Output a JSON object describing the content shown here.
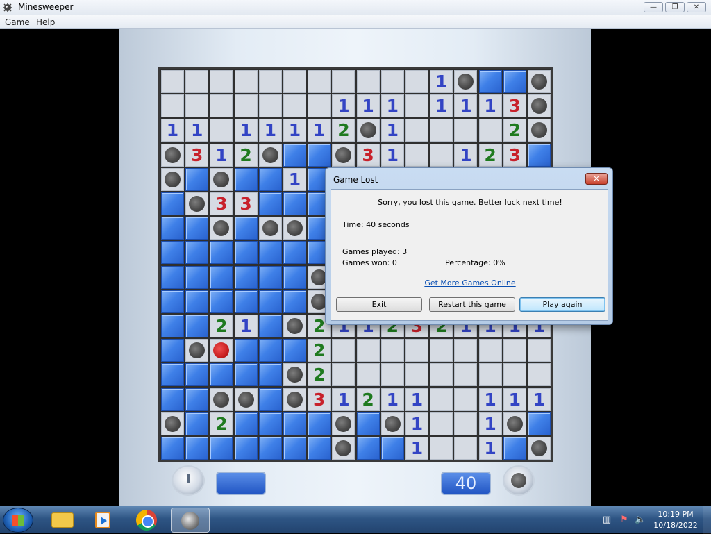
{
  "window": {
    "title": "Minesweeper",
    "controls": {
      "minimize": "—",
      "maximize": "❐",
      "close": "✕"
    }
  },
  "menu": {
    "game": "Game",
    "help": "Help"
  },
  "board": {
    "rows": [
      [
        "r",
        "r",
        "r",
        "r",
        "r",
        "r",
        "r",
        "r",
        "r",
        "r",
        "r",
        "1",
        "m",
        "u",
        "u",
        "m"
      ],
      [
        "r",
        "r",
        "r",
        "r",
        "r",
        "r",
        "r",
        "1",
        "1",
        "1",
        "r",
        "1",
        "1",
        "1",
        "3",
        "m"
      ],
      [
        "1",
        "1",
        "r",
        "1",
        "1",
        "1",
        "1",
        "2",
        "m",
        "1",
        "r",
        "r",
        "r",
        "r",
        "2",
        "m"
      ],
      [
        "m",
        "3",
        "1",
        "2",
        "m",
        "u",
        "u",
        "m",
        "3",
        "1",
        "r",
        "r",
        "1",
        "2",
        "3",
        "u"
      ],
      [
        "m",
        "u",
        "m",
        "u",
        "u",
        "1",
        "u",
        "u",
        "u",
        "u",
        "u",
        "u",
        "u",
        "u",
        "u",
        "u"
      ],
      [
        "u",
        "m",
        "3",
        "3",
        "u",
        "u",
        "u",
        "u",
        "u",
        "u",
        "u",
        "u",
        "u",
        "u",
        "u",
        "u"
      ],
      [
        "u",
        "u",
        "m",
        "u",
        "m",
        "m",
        "u",
        "u",
        "u",
        "u",
        "u",
        "u",
        "u",
        "u",
        "u",
        "u"
      ],
      [
        "u",
        "u",
        "u",
        "u",
        "u",
        "u",
        "u",
        "u",
        "u",
        "u",
        "u",
        "u",
        "u",
        "u",
        "u",
        "u"
      ],
      [
        "u",
        "u",
        "u",
        "u",
        "u",
        "u",
        "m",
        "u",
        "u",
        "u",
        "u",
        "u",
        "u",
        "u",
        "u",
        "u"
      ],
      [
        "u",
        "u",
        "u",
        "u",
        "u",
        "u",
        "m",
        "u",
        "u",
        "u",
        "u",
        "u",
        "u",
        "u",
        "u",
        "u"
      ],
      [
        "u",
        "u",
        "2",
        "1",
        "u",
        "m",
        "2",
        "1",
        "1",
        "2",
        "3",
        "2",
        "1",
        "1",
        "1",
        "1"
      ],
      [
        "u",
        "m",
        "x",
        "u",
        "u",
        "u",
        "2",
        "r",
        "r",
        "r",
        "r",
        "r",
        "r",
        "r",
        "r",
        "r"
      ],
      [
        "u",
        "u",
        "u",
        "u",
        "u",
        "m",
        "2",
        "r",
        "r",
        "r",
        "r",
        "r",
        "r",
        "r",
        "r",
        "r"
      ],
      [
        "u",
        "u",
        "m",
        "m",
        "u",
        "m",
        "3",
        "1",
        "2",
        "1",
        "1",
        "r",
        "r",
        "1",
        "1",
        "1"
      ],
      [
        "m",
        "u",
        "2",
        "u",
        "u",
        "u",
        "u",
        "m",
        "u",
        "m",
        "1",
        "r",
        "r",
        "1",
        "m",
        "u"
      ],
      [
        "u",
        "u",
        "u",
        "u",
        "u",
        "u",
        "u",
        "m",
        "u",
        "u",
        "1",
        "r",
        "r",
        "1",
        "u",
        "m"
      ]
    ],
    "legend": {
      "u": "unopened",
      "r": "revealed-empty",
      "m": "mine",
      "x": "exploded-mine"
    }
  },
  "counters": {
    "time_value": "",
    "mines_value": "40"
  },
  "dialog": {
    "title": "Game Lost",
    "close": "✕",
    "message": "Sorry, you lost this game. Better luck next time!",
    "time": "Time: 40 seconds",
    "games_played": "Games played: 3",
    "games_won": "Games won: 0",
    "percentage": "Percentage: 0%",
    "link": "Get More Games Online",
    "buttons": {
      "exit": "Exit",
      "restart": "Restart this game",
      "play_again": "Play again"
    }
  },
  "taskbar": {
    "clock_time": "10:19 PM",
    "clock_date": "10/18/2022"
  },
  "colors": {
    "accent": "#2a63cf",
    "num1": "#3344c4",
    "num2": "#1f7a1f",
    "num3": "#c8212b"
  }
}
